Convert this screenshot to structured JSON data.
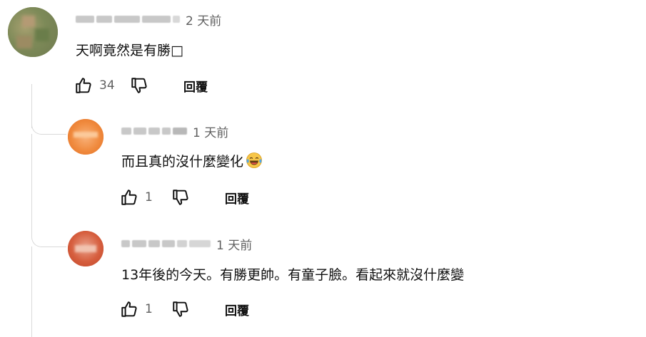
{
  "comments": [
    {
      "time": "2 天前",
      "text": "天啊竟然是有勝□",
      "likes": "34",
      "reply_label": "回覆"
    },
    {
      "time": "1 天前",
      "text": "而且真的沒什麼變化",
      "emoji": "laughing-tears-emoji",
      "likes": "1",
      "reply_label": "回覆"
    },
    {
      "time": "1 天前",
      "text": "13年後的今天。有勝更帥。有童子臉。看起來就沒什麼變",
      "likes": "1",
      "reply_label": "回覆"
    }
  ],
  "icons": {
    "like": "thumbs-up-icon",
    "dislike": "thumbs-down-icon"
  },
  "colors": {
    "text": "#0f0f0f",
    "secondary": "#606060",
    "thread_line": "#d9d9d9"
  }
}
